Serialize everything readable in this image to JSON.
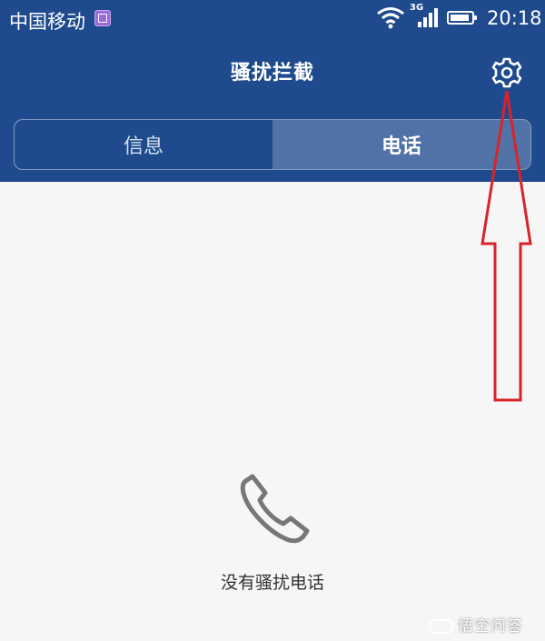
{
  "status_bar": {
    "carrier": "中国移动",
    "network": "3G",
    "time": "20:18"
  },
  "header": {
    "title": "骚扰拦截",
    "settings_icon": "gear-icon"
  },
  "tabs": [
    {
      "label": "信息",
      "selected": false
    },
    {
      "label": "电话",
      "selected": true
    }
  ],
  "empty_state": {
    "icon": "phone-icon",
    "message": "没有骚扰电话"
  },
  "watermark": {
    "text": "悟空问答"
  },
  "colors": {
    "header_bg": "#1f4b8e",
    "body_bg": "#f6f6f6",
    "annotation_arrow": "#d9232b"
  }
}
